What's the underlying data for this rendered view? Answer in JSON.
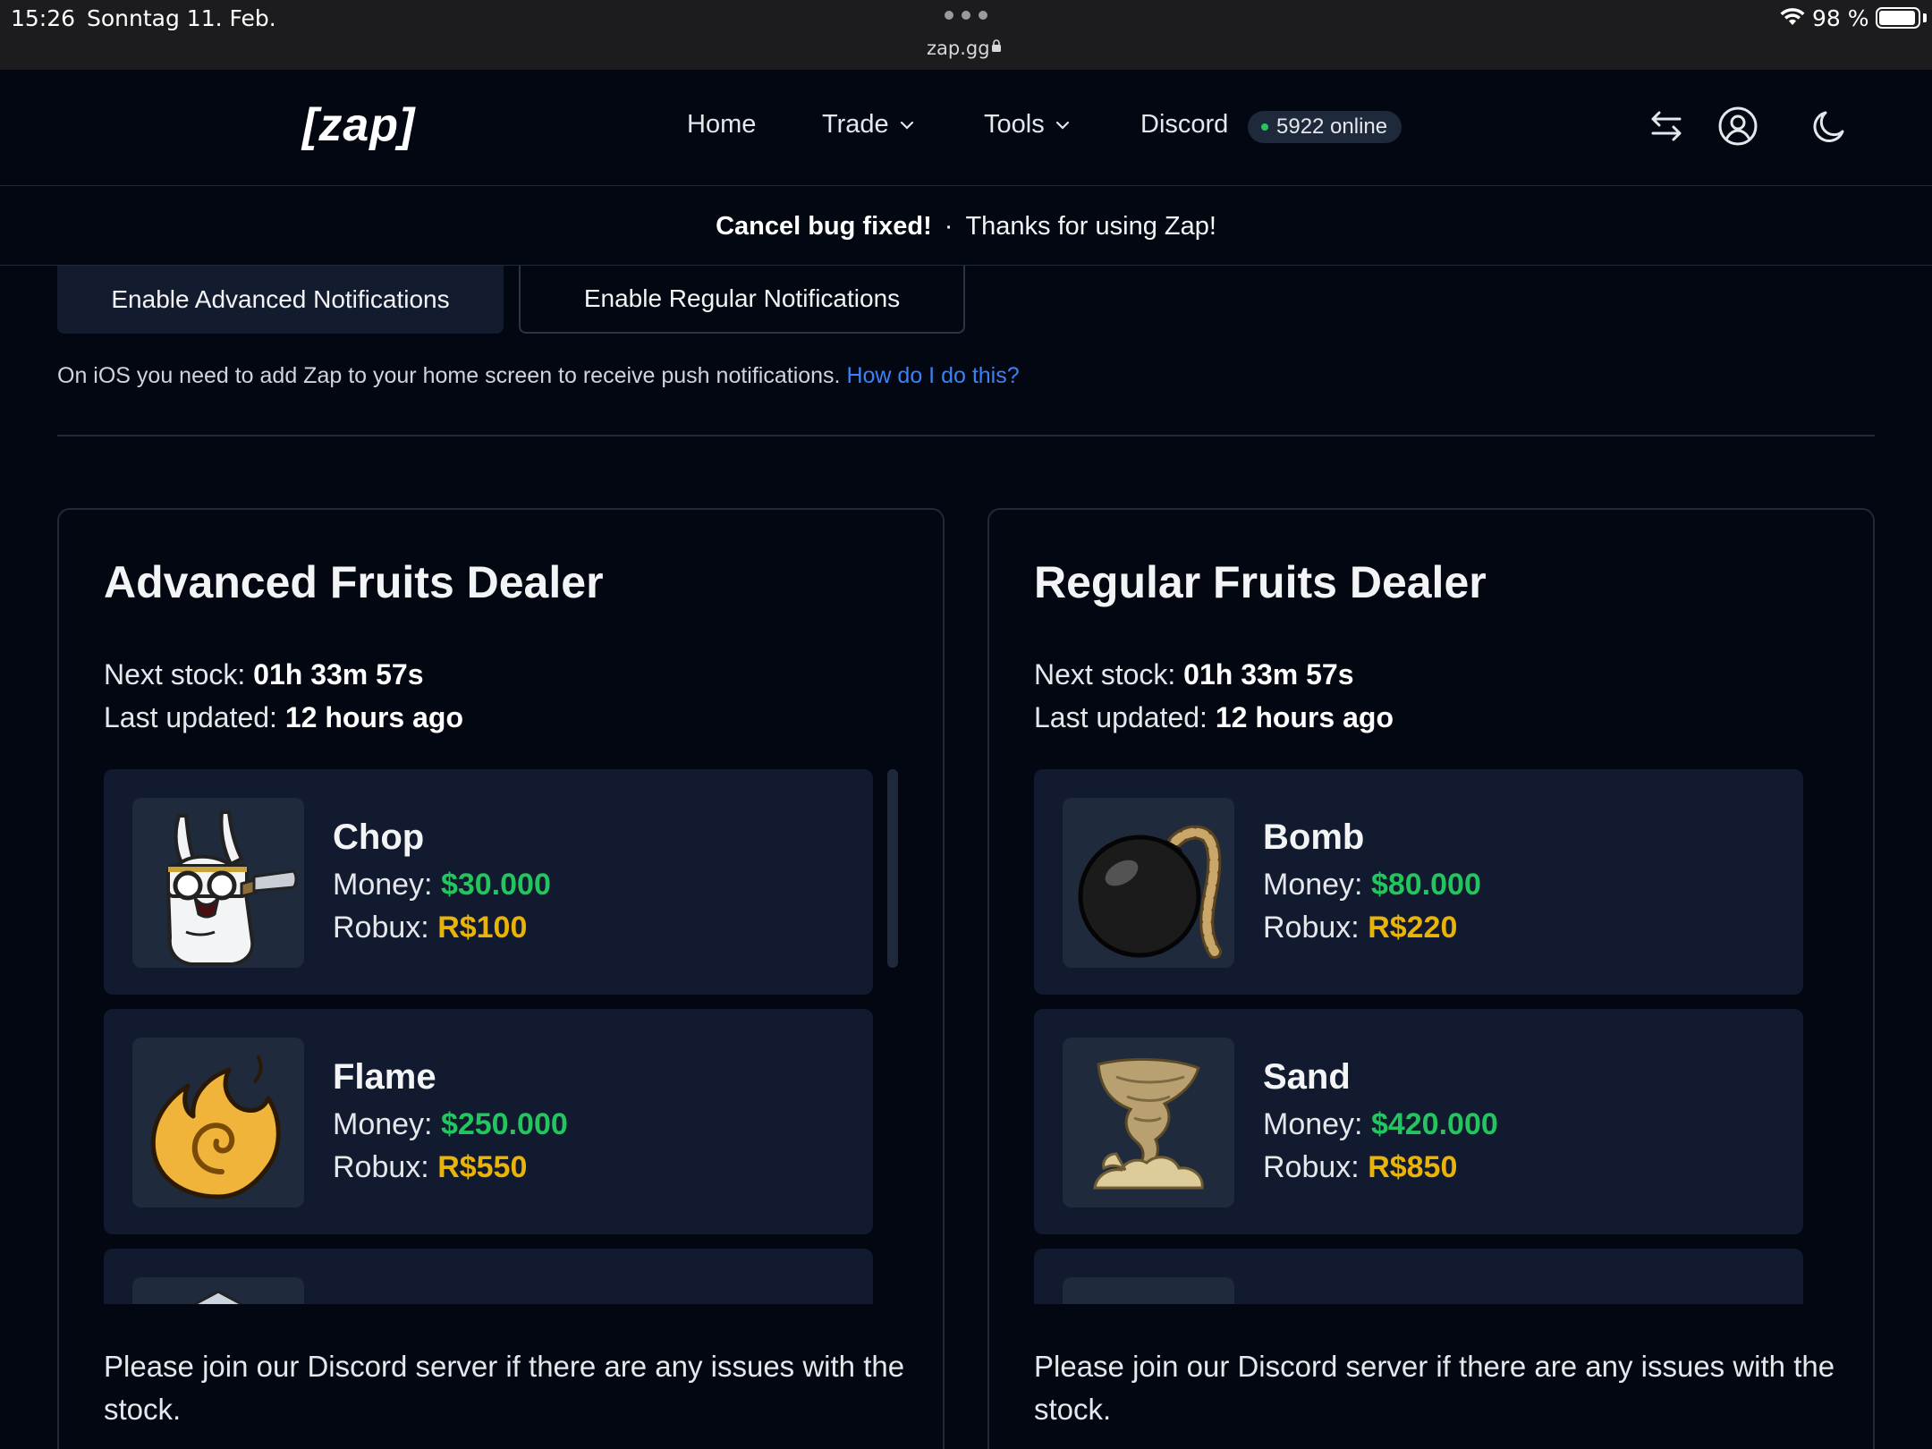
{
  "status_bar": {
    "time": "15:26",
    "date": "Sonntag 11. Feb.",
    "url": "zap.gg",
    "battery": "98 %"
  },
  "header": {
    "logo": "[zap]",
    "nav": {
      "home": "Home",
      "trade": "Trade",
      "tools": "Tools",
      "discord": "Discord",
      "online": "5922 online"
    }
  },
  "announcement": {
    "bold": "Cancel bug fixed!",
    "separator": "·",
    "text": "Thanks for using Zap!"
  },
  "notifications": {
    "advanced_button": "Enable Advanced Notifications",
    "regular_button": "Enable Regular Notifications",
    "ios_note": "On iOS you need to add Zap to your home screen to receive push notifications.",
    "ios_link": "How do I do this?"
  },
  "dealers": {
    "advanced": {
      "title": "Advanced Fruits Dealer",
      "next_label": "Next stock:",
      "next_value": "01h 33m 57s",
      "updated_label": "Last updated:",
      "updated_value": "12 hours ago",
      "items": [
        {
          "name": "Chop",
          "money_label": "Money:",
          "money": "$30.000",
          "robux_label": "Robux:",
          "robux": "R$100",
          "icon": "chop-fruit-icon"
        },
        {
          "name": "Flame",
          "money_label": "Money:",
          "money": "$250.000",
          "robux_label": "Robux:",
          "robux": "R$550",
          "icon": "flame-fruit-icon"
        }
      ],
      "footer": "Please join our Discord server if there are any issues with the stock."
    },
    "regular": {
      "title": "Regular Fruits Dealer",
      "next_label": "Next stock:",
      "next_value": "01h 33m 57s",
      "updated_label": "Last updated:",
      "updated_value": "12 hours ago",
      "items": [
        {
          "name": "Bomb",
          "money_label": "Money:",
          "money": "$80.000",
          "robux_label": "Robux:",
          "robux": "R$220",
          "icon": "bomb-fruit-icon"
        },
        {
          "name": "Sand",
          "money_label": "Money:",
          "money": "$420.000",
          "robux_label": "Robux:",
          "robux": "R$850",
          "icon": "sand-fruit-icon"
        }
      ],
      "footer": "Please join our Discord server if there are any issues with the stock."
    }
  },
  "colors": {
    "background": "#030712",
    "card": "#111a2e",
    "money": "#22c55e",
    "robux": "#eab308",
    "link": "#3b82f6",
    "online_dot": "#22c55e"
  }
}
